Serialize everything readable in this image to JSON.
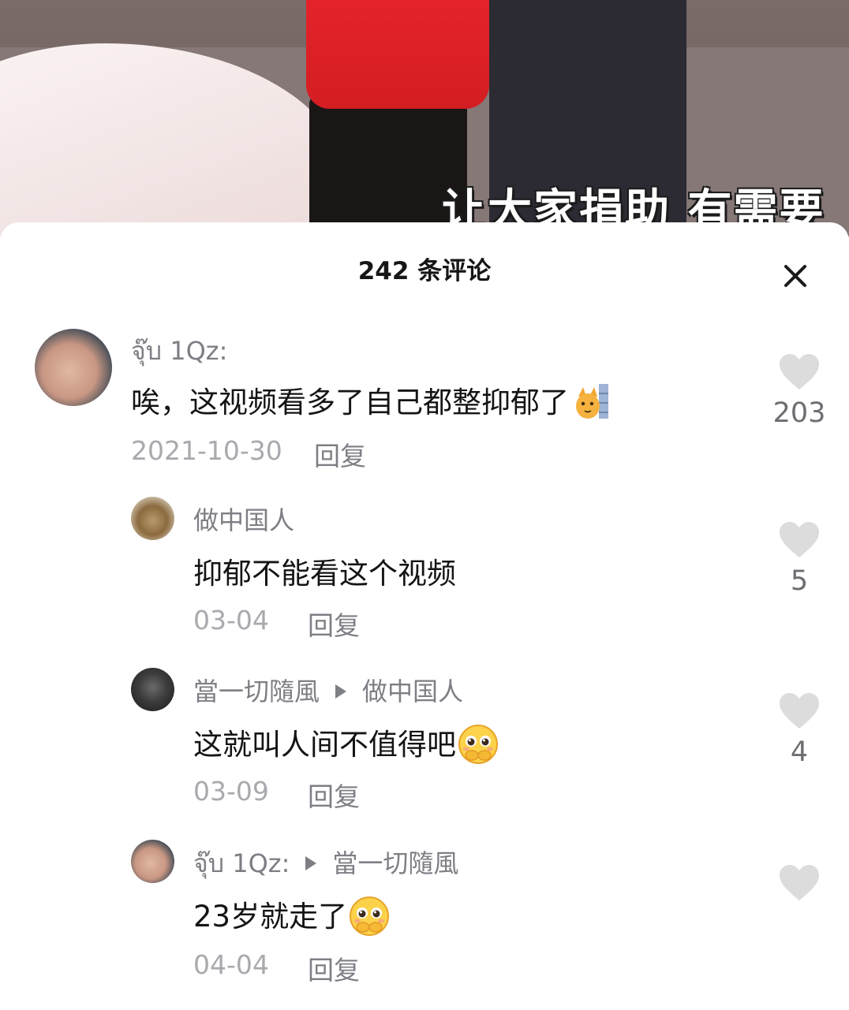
{
  "video": {
    "subtitle": "让大家捐助  有需要"
  },
  "sheet": {
    "title": "242 条评论"
  },
  "comments": [
    {
      "author": "จุ๊บ 1Qz:",
      "text": "唉，这视频看多了自己都整抑郁了",
      "emoji_icon": "cat-peeking-emoji-icon",
      "date": "2021-10-30",
      "reply_label": "回复",
      "likes": "203"
    },
    {
      "author": "做中国人",
      "text": "抑郁不能看这个视频",
      "date": "03-04",
      "reply_label": "回复",
      "likes": "5"
    },
    {
      "author": "當一切隨風",
      "reply_to": "做中国人",
      "text": "这就叫人间不值得吧",
      "emoji_icon": "pleading-face-emoji-icon",
      "date": "03-09",
      "reply_label": "回复",
      "likes": "4"
    },
    {
      "author": "จุ๊บ 1Qz:",
      "reply_to": "當一切隨風",
      "text": "23岁就走了",
      "emoji_icon": "pleading-face-emoji-icon",
      "date": "04-04",
      "reply_label": "回复",
      "likes": ""
    }
  ],
  "colors": {
    "like_heart": "#dcdcdc",
    "meta_text": "#7e7e85",
    "date_text": "#a9a9ae",
    "body_text": "#141414",
    "subtitle_stroke": "#1b1b1b"
  }
}
